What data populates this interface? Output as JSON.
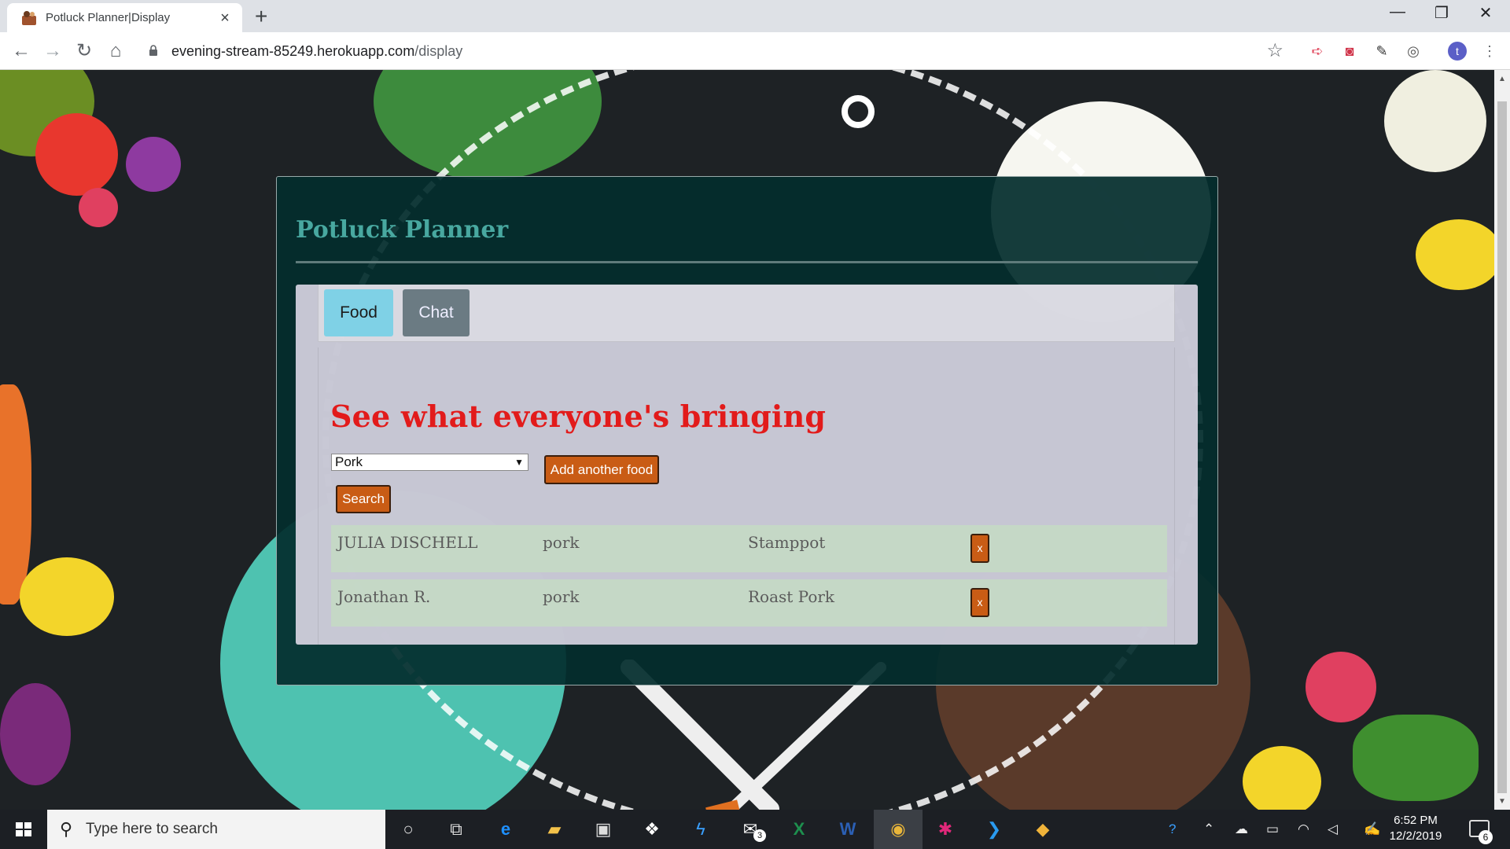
{
  "browser": {
    "tab_title": "Potluck Planner|Display",
    "tab_close": "×",
    "new_tab": "+",
    "url_host": "evening-stream-85249.herokuapp.com",
    "url_path": "/display",
    "profile_initial": "t",
    "window_controls": {
      "minimize": "—",
      "maximize": "❐",
      "close": "✕"
    }
  },
  "app": {
    "title": "Potluck Planner",
    "tabs": [
      {
        "label": "Food",
        "active": true
      },
      {
        "label": "Chat",
        "active": false
      }
    ],
    "heading": "See what everyone's bringing",
    "filter": {
      "selected": "Pork"
    },
    "add_button": "Add another food",
    "search_button": "Search",
    "delete_label": "x",
    "rows": [
      {
        "name": "JULIA DISCHELL",
        "category": "pork",
        "dish": "Stamppot"
      },
      {
        "name": "Jonathan R.",
        "category": "pork",
        "dish": "Roast Pork"
      }
    ]
  },
  "taskbar": {
    "search_placeholder": "Type here to search",
    "time": "6:52 PM",
    "date": "12/2/2019",
    "mail_badge": "3",
    "notification_count": "6"
  },
  "colors": {
    "panel": "#032d2d",
    "title": "#48a8a0",
    "heading": "#e21b1b",
    "button": "#c95c15",
    "food_tab": "#7fd1e6",
    "chat_tab": "#6b7b83"
  }
}
